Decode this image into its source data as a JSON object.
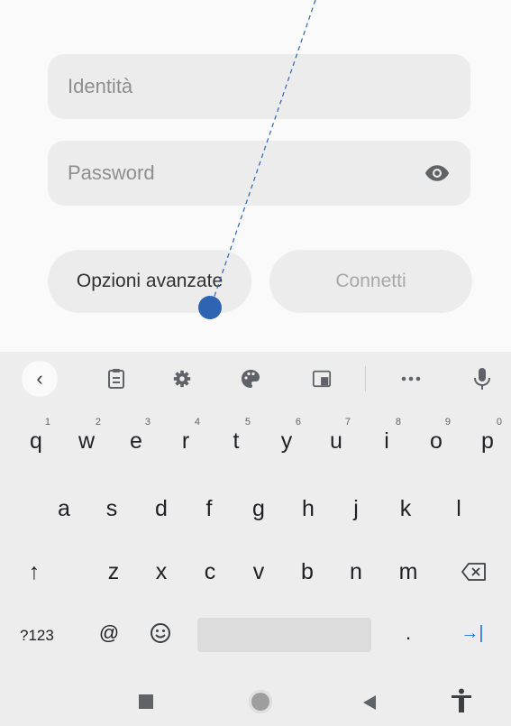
{
  "form": {
    "identity_placeholder": "Identità",
    "password_placeholder": "Password",
    "advanced_button": "Opzioni avanzate",
    "connect_button": "Connetti"
  },
  "keyboard": {
    "row1": [
      {
        "key": "q",
        "num": "1"
      },
      {
        "key": "w",
        "num": "2"
      },
      {
        "key": "e",
        "num": "3"
      },
      {
        "key": "r",
        "num": "4"
      },
      {
        "key": "t",
        "num": "5"
      },
      {
        "key": "y",
        "num": "6"
      },
      {
        "key": "u",
        "num": "7"
      },
      {
        "key": "i",
        "num": "8"
      },
      {
        "key": "o",
        "num": "9"
      },
      {
        "key": "p",
        "num": "0"
      }
    ],
    "row2": [
      "a",
      "s",
      "d",
      "f",
      "g",
      "h",
      "j",
      "k",
      "l"
    ],
    "row3": [
      "z",
      "x",
      "c",
      "v",
      "b",
      "n",
      "m"
    ],
    "symbols_key": "?123",
    "at_key": "@",
    "period_key": ".",
    "shift_icon": "↑",
    "tab_icon": "→|"
  },
  "colors": {
    "accent": "#1a73e8",
    "pointer": "#2f64b3"
  }
}
